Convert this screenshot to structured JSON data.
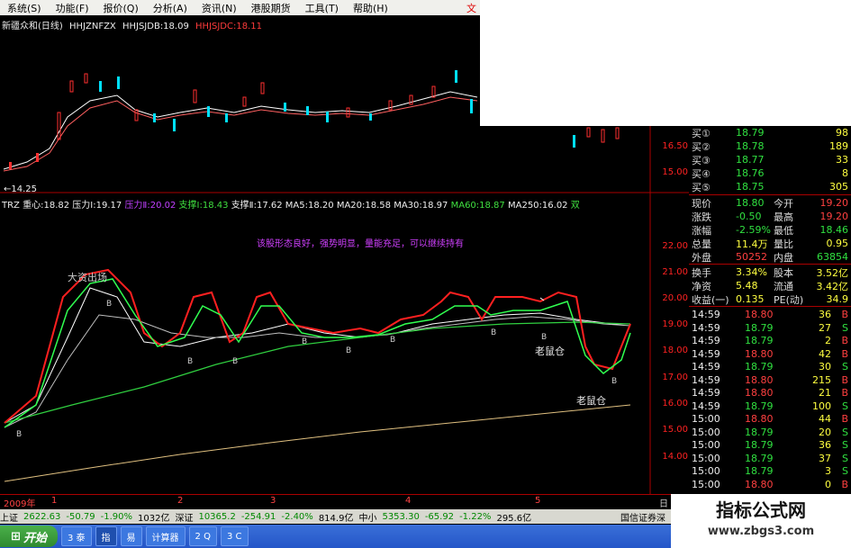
{
  "menu": [
    "系统(S)",
    "功能(F)",
    "报价(Q)",
    "分析(A)",
    "资讯(N)",
    "港股期货",
    "工具(T)",
    "帮助(H)"
  ],
  "menu_close": "文",
  "stock_title": {
    "name": "新疆众和(日线)",
    "f1": "HHJZNFZX",
    "f2": "HHJSJDB:18.09",
    "f3": "HHJSJDC:18.11"
  },
  "price_low_label": "←14.25",
  "upper_ticks": [
    "16.50",
    "15.00"
  ],
  "indicator_line": {
    "name": "TRZ",
    "zx": "重心:18.82",
    "yl1": "压力Ⅰ:19.17",
    "yl2": "压力Ⅱ:20.02",
    "zc1": "支撑Ⅰ:18.43",
    "zc2": "支撑Ⅱ:17.62",
    "ma5": "MA5:18.20",
    "ma20": "MA20:18.58",
    "ma30": "MA30:18.97",
    "ma60": "MA60:18.87",
    "ma250": "MA250:16.02",
    "extra": "双"
  },
  "lower_ticks": [
    "22.00",
    "21.00",
    "20.00",
    "19.00",
    "18.00",
    "17.00",
    "16.00",
    "15.00",
    "14.00"
  ],
  "annotations": {
    "comment": "该股形态良好，强势明显，量能充足，可以继续持有",
    "big_bull": "大资出场",
    "rat1": "老鼠仓",
    "rat2": "老鼠仓",
    "b": "B"
  },
  "panel": {
    "bids": [
      {
        "label": "买①",
        "price": "18.79",
        "vol": "98"
      },
      {
        "label": "买②",
        "price": "18.78",
        "vol": "189"
      },
      {
        "label": "买③",
        "price": "18.77",
        "vol": "33"
      },
      {
        "label": "买④",
        "price": "18.76",
        "vol": "8"
      },
      {
        "label": "买⑤",
        "price": "18.75",
        "vol": "305"
      }
    ],
    "stats": [
      {
        "l1": "现价",
        "v1": "18.80",
        "l2": "今开",
        "v2": "19.20"
      },
      {
        "l1": "涨跌",
        "v1": "-0.50",
        "l2": "最高",
        "v2": "19.20"
      },
      {
        "l1": "涨幅",
        "v1": "-2.59%",
        "l2": "最低",
        "v2": "18.46"
      },
      {
        "l1": "总量",
        "v1": "11.4万",
        "l2": "量比",
        "v2": "0.95"
      },
      {
        "l1": "外盘",
        "v1": "50252",
        "l2": "内盘",
        "v2": "63854"
      },
      {
        "l1": "换手",
        "v1": "3.34%",
        "l2": "股本",
        "v2": "3.52亿"
      },
      {
        "l1": "净资",
        "v1": "5.48",
        "l2": "流通",
        "v2": "3.42亿"
      },
      {
        "l1": "收益(一)",
        "v1": "0.135",
        "l2": "PE(动)",
        "v2": "34.9"
      }
    ],
    "ticks": [
      {
        "t": "14:59",
        "p": "18.80",
        "v": "36",
        "s": "B"
      },
      {
        "t": "14:59",
        "p": "18.79",
        "v": "27",
        "s": "S"
      },
      {
        "t": "14:59",
        "p": "18.79",
        "v": "2",
        "s": "B"
      },
      {
        "t": "14:59",
        "p": "18.80",
        "v": "42",
        "s": "B"
      },
      {
        "t": "14:59",
        "p": "18.79",
        "v": "30",
        "s": "S"
      },
      {
        "t": "14:59",
        "p": "18.80",
        "v": "215",
        "s": "B"
      },
      {
        "t": "14:59",
        "p": "18.80",
        "v": "21",
        "s": "B"
      },
      {
        "t": "14:59",
        "p": "18.79",
        "v": "100",
        "s": "S"
      },
      {
        "t": "15:00",
        "p": "18.80",
        "v": "44",
        "s": "B"
      },
      {
        "t": "15:00",
        "p": "18.79",
        "v": "20",
        "s": "S"
      },
      {
        "t": "15:00",
        "p": "18.79",
        "v": "36",
        "s": "S"
      },
      {
        "t": "15:00",
        "p": "18.79",
        "v": "37",
        "s": "S"
      },
      {
        "t": "15:00",
        "p": "18.79",
        "v": "3",
        "s": "S"
      },
      {
        "t": "15:00",
        "p": "18.80",
        "v": "0",
        "s": "B"
      }
    ]
  },
  "dates": [
    "2009年",
    "1",
    "2",
    "3",
    "4",
    "5",
    "日"
  ],
  "status": [
    "上证",
    "2622.63",
    "-50.79",
    "-1.90%",
    "1032亿",
    "深证",
    "10365.2",
    "-254.91",
    "-2.40%",
    "814.9亿",
    "中小",
    "5353.30",
    "-65.92",
    "-1.22%",
    "295.6亿",
    "国信证券深"
  ],
  "taskbar": {
    "start": "开始",
    "tasks": [
      "3 泰",
      "指",
      "易",
      "计算器",
      "2 Q",
      "3 C"
    ]
  },
  "watermark": {
    "line1": "指标公式网",
    "line2": "www.zbgs3.com"
  }
}
